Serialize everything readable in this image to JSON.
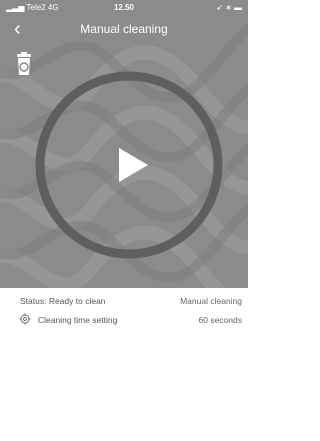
{
  "status_bar": {
    "carrier": "Tele2",
    "network": "4G",
    "time": "12.50",
    "right_icons": "location-bluetooth-battery"
  },
  "nav": {
    "title": "Manual cleaning",
    "back_icon": "chevron-left-icon"
  },
  "hero": {
    "trash_icon": "trash-can-icon",
    "play_icon": "play-icon"
  },
  "info": {
    "status_label": "Status: Ready to clean",
    "mode_value": "Manual cleaning",
    "time_setting_label": "Cleaning time setting",
    "time_setting_value": "60 seconds"
  },
  "colors": {
    "hero_bg": "#8a8a8a",
    "accent": "#555555"
  }
}
